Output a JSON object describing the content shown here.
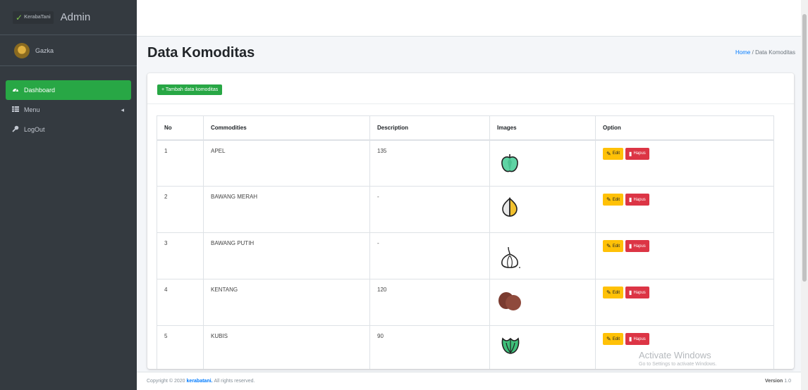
{
  "sidebar": {
    "brand_mark": "✓",
    "brand_logo_text": "KerabaTani",
    "brand_name": "Admin",
    "user_name": "Gazka",
    "nav": [
      {
        "label": "Dashboard",
        "icon": "tachometer-icon"
      },
      {
        "label": "Menu",
        "icon": "table-icon"
      },
      {
        "label": "LogOut",
        "icon": "key-icon"
      }
    ]
  },
  "header": {
    "title": "Data Komoditas",
    "breadcrumb_home": "Home",
    "breadcrumb_sep": "/",
    "breadcrumb_current": "Data Komoditas"
  },
  "card": {
    "add_button": "+ Tambah data komoditas",
    "columns": [
      "No",
      "Commodities",
      "Description",
      "Images",
      "Option"
    ],
    "rows": [
      {
        "no": "1",
        "commodity": "APEL",
        "description": "135",
        "image": "apple-icon"
      },
      {
        "no": "2",
        "commodity": "BAWANG MERAH",
        "description": "-",
        "image": "onion-icon"
      },
      {
        "no": "3",
        "commodity": "BAWANG PUTIH",
        "description": "-",
        "image": "garlic-icon"
      },
      {
        "no": "4",
        "commodity": "KENTANG",
        "description": "120",
        "image": "potato-icon"
      },
      {
        "no": "5",
        "commodity": "KUBIS",
        "description": "90",
        "image": "cabbage-icon"
      }
    ],
    "edit_label": "Edit",
    "delete_label": "Hapus"
  },
  "footer": {
    "copyright_prefix": "Copyright © 2020",
    "brand_link": "kerabatani.",
    "copyright_suffix": "All rights reserved.",
    "version_label": "Version",
    "version_value": "1.0"
  },
  "watermark": {
    "line1": "Activate Windows",
    "line2": "Go to Settings to activate Windows."
  },
  "colors": {
    "sidebar": "#343a40",
    "active": "#28a745",
    "edit": "#ffc107",
    "delete": "#dc3545",
    "link": "#007bff"
  }
}
